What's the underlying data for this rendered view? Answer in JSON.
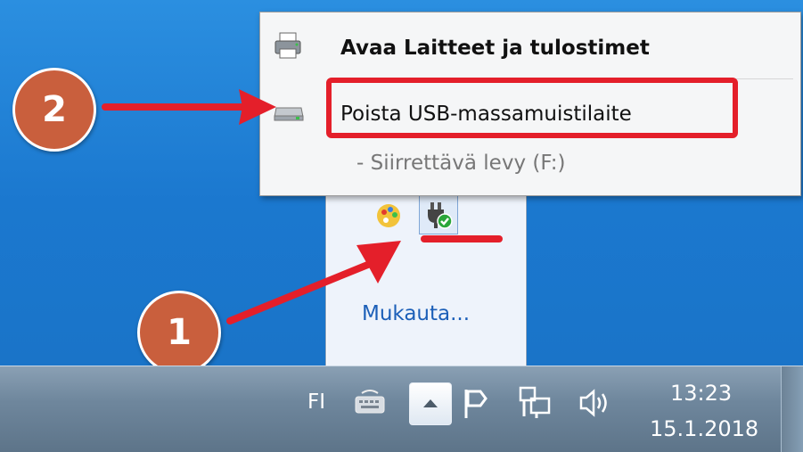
{
  "menu": {
    "open_devices_label": "Avaa Laitteet ja tulostimet",
    "eject_label": "Poista USB-massamuistilaite",
    "sub_item_label": "-   Siirrettävä levy (F:)"
  },
  "tray_popup": {
    "customize_label": "Mukauta..."
  },
  "annotations": {
    "step_1": "1",
    "step_2": "2",
    "highlight_color": "#e41f2a"
  },
  "taskbar": {
    "language": "FI",
    "time": "13:23",
    "date": "15.1.2018"
  },
  "icons": [
    "printer-icon",
    "usb-drive-icon",
    "paint-palette-icon",
    "safely-remove-hardware-icon",
    "keyboard-icon",
    "show-hidden-icons-arrow-icon",
    "action-center-flag-icon",
    "network-icon",
    "volume-icon"
  ]
}
